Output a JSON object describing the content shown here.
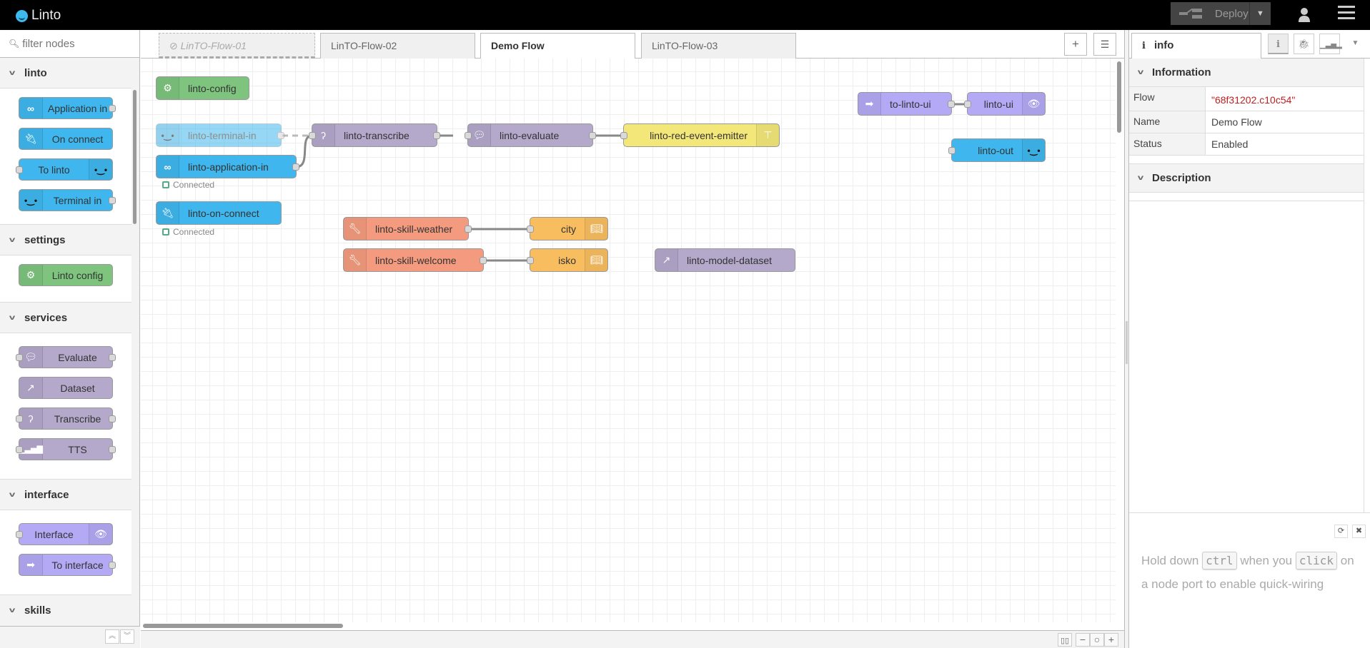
{
  "header": {
    "app_title": "Linto",
    "deploy_label": "Deploy"
  },
  "palette": {
    "search_placeholder": "filter nodes",
    "categories": [
      {
        "name": "linto",
        "nodes": [
          {
            "label": "Application in",
            "color": "#3fb7ee",
            "icon": "infinity-icon"
          },
          {
            "label": "On connect",
            "color": "#3fb7ee",
            "icon": "plug-icon"
          },
          {
            "label": "To linto",
            "color": "#3fb7ee",
            "icon": "face-icon"
          },
          {
            "label": "Terminal in",
            "color": "#3fb7ee",
            "icon": "face-icon"
          }
        ]
      },
      {
        "name": "settings",
        "nodes": [
          {
            "label": "Linto config",
            "color": "#7ec47e",
            "icon": "cogs-icon"
          }
        ]
      },
      {
        "name": "services",
        "nodes": [
          {
            "label": "Evaluate",
            "color": "#b4a8cb",
            "icon": "comments-icon"
          },
          {
            "label": "Dataset",
            "color": "#b4a8cb",
            "icon": "external-link-icon"
          },
          {
            "label": "Transcribe",
            "color": "#b4a8cb",
            "icon": "ear-icon"
          },
          {
            "label": "TTS",
            "color": "#b4a8cb",
            "icon": "signal-icon"
          }
        ]
      },
      {
        "name": "interface",
        "nodes": [
          {
            "label": "Interface",
            "color": "#b3a9f5",
            "icon": "eye-icon"
          },
          {
            "label": "To interface",
            "color": "#b3a9f5",
            "icon": "arrow-icon"
          }
        ]
      },
      {
        "name": "skills",
        "nodes": []
      }
    ]
  },
  "workspace": {
    "tabs": [
      {
        "label": "LinTO-Flow-01",
        "state": "disabled"
      },
      {
        "label": "LinTO-Flow-02",
        "state": "normal"
      },
      {
        "label": "Demo Flow",
        "state": "active"
      },
      {
        "label": "LinTO-Flow-03",
        "state": "normal"
      }
    ],
    "nodes": {
      "linto_config": "linto-config",
      "terminal_in": "linto-terminal-in",
      "application_in": "linto-application-in",
      "on_connect": "linto-on-connect",
      "transcribe": "linto-transcribe",
      "evaluate": "linto-evaluate",
      "event_emitter": "linto-red-event-emitter",
      "skill_weather": "linto-skill-weather",
      "skill_welcome": "linto-skill-welcome",
      "city": "city",
      "isko": "isko",
      "model_dataset": "linto-model-dataset",
      "to_linto_ui": "to-linto-ui",
      "linto_ui": "linto-ui",
      "linto_out": "linto-out"
    },
    "status_application_in": "Connected",
    "status_on_connect": "Connected",
    "colors": {
      "linto_blue": "#3fb7ee",
      "config_green": "#7ec47e",
      "service_purple": "#b4a8cb",
      "skill_salmon": "#f49b7f",
      "dict_orange": "#f8bd5f",
      "emitter_yellow": "#f3e77a",
      "interface_violet": "#b3a9f5"
    }
  },
  "sidebar": {
    "tab_label": "info",
    "section_information": "Information",
    "section_description": "Description",
    "info_rows": [
      {
        "key": "Flow",
        "value": "\"68f31202.c10c54\""
      },
      {
        "key": "Name",
        "value": "Demo Flow"
      },
      {
        "key": "Status",
        "value": "Enabled"
      }
    ],
    "tip": {
      "text_1": "Hold down",
      "key_1": "ctrl",
      "text_2": "when you",
      "key_2": "click",
      "text_3": "on a node port to enable quick-wiring"
    }
  }
}
